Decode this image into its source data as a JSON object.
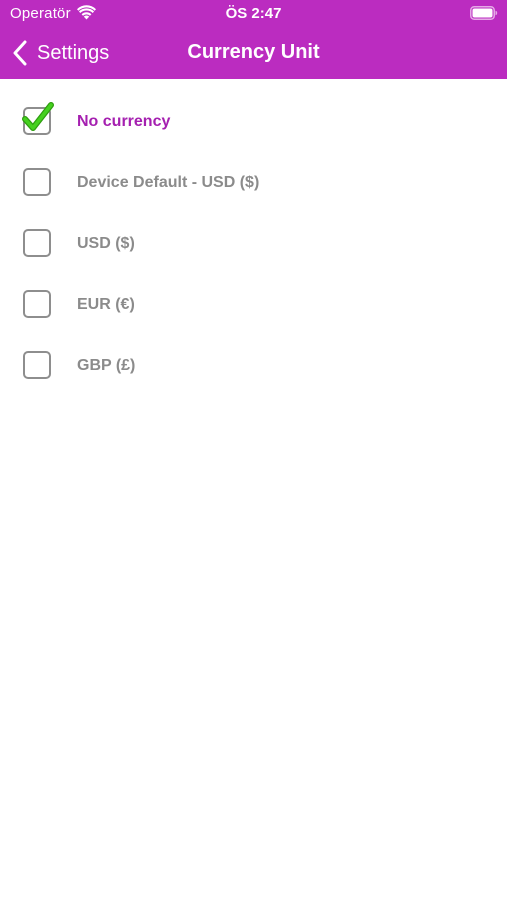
{
  "status_bar": {
    "carrier": "Operatör",
    "time": "ÖS 2:47",
    "wifi_icon": "wifi-icon",
    "battery_icon": "battery-full-icon"
  },
  "nav": {
    "back_label": "Settings",
    "title": "Currency Unit"
  },
  "colors": {
    "header_bg": "#bb2cc0",
    "selected_text": "#a520b0",
    "unselected_text": "#8b8b8b",
    "checkmark": "#3dc41a"
  },
  "options": [
    {
      "label": "No currency",
      "selected": true
    },
    {
      "label": "Device Default - USD ($)",
      "selected": false
    },
    {
      "label": "USD ($)",
      "selected": false
    },
    {
      "label": "EUR (€)",
      "selected": false
    },
    {
      "label": "GBP (£)",
      "selected": false
    }
  ]
}
